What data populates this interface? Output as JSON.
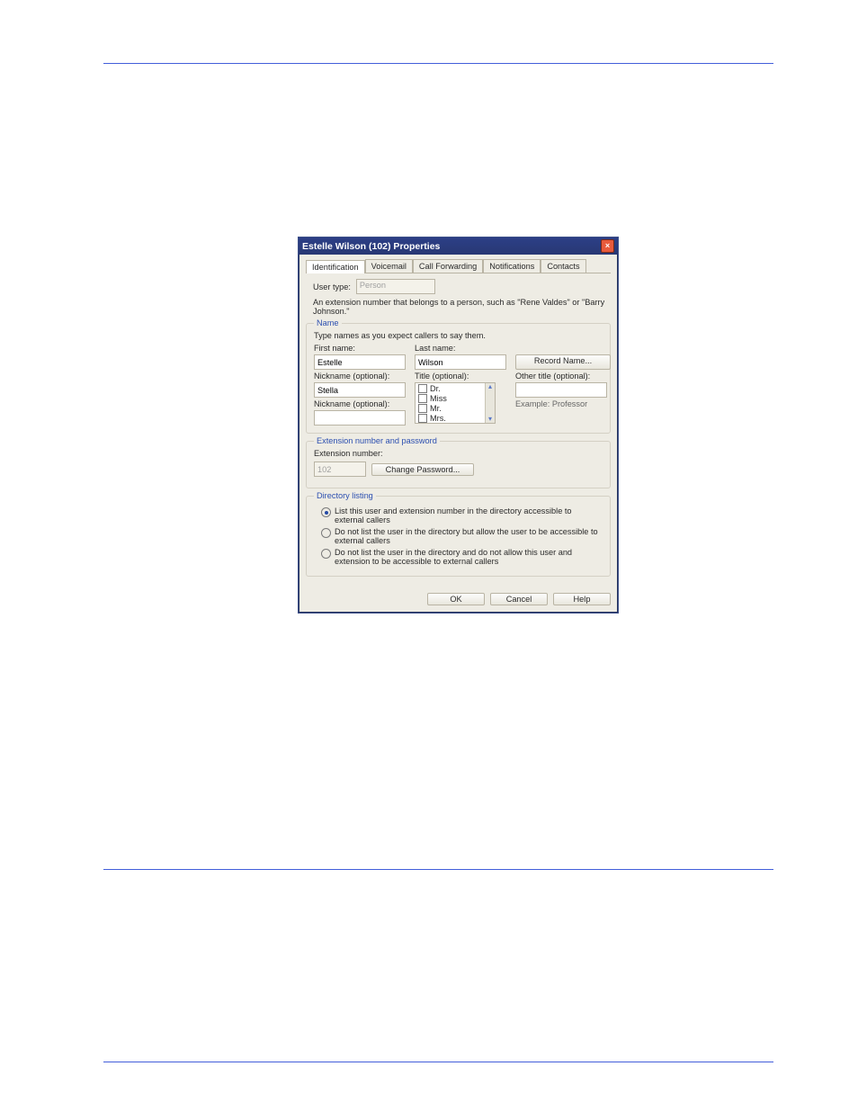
{
  "dialog": {
    "title": "Estelle Wilson (102) Properties",
    "close_icon": "×",
    "tabs": [
      {
        "label": "Identification",
        "active": true
      },
      {
        "label": "Voicemail"
      },
      {
        "label": "Call Forwarding"
      },
      {
        "label": "Notifications"
      },
      {
        "label": "Contacts"
      }
    ],
    "user_type": {
      "label": "User type:",
      "value": "Person",
      "note": "An extension number that belongs to a person, such as \"Rene Valdes\" or \"Barry Johnson.\""
    },
    "name_group": {
      "title": "Name",
      "hint": "Type names as you expect callers to say them.",
      "first_label": "First name:",
      "first_value": "Estelle",
      "last_label": "Last name:",
      "last_value": "Wilson",
      "record_btn": "Record Name...",
      "nick1_label": "Nickname (optional):",
      "nick1_value": "Stella",
      "nick2_label": "Nickname (optional):",
      "nick2_value": "",
      "title_label": "Title (optional):",
      "title_options": [
        "Dr.",
        "Miss",
        "Mr.",
        "Mrs."
      ],
      "other_title_label": "Other title (optional):",
      "other_title_value": "",
      "example": "Example: Professor"
    },
    "ext_group": {
      "title": "Extension number and password",
      "ext_label": "Extension number:",
      "ext_value": "102",
      "change_pw_btn": "Change Password..."
    },
    "dir_group": {
      "title": "Directory listing",
      "opt1": "List this user and extension number in the directory accessible to external callers",
      "opt2": "Do not list the user in the directory but allow the user to be accessible to external callers",
      "opt3": "Do not list the user in the directory and do not allow this user and extension to be accessible to external callers"
    },
    "buttons": {
      "ok": "OK",
      "cancel": "Cancel",
      "help": "Help"
    }
  }
}
